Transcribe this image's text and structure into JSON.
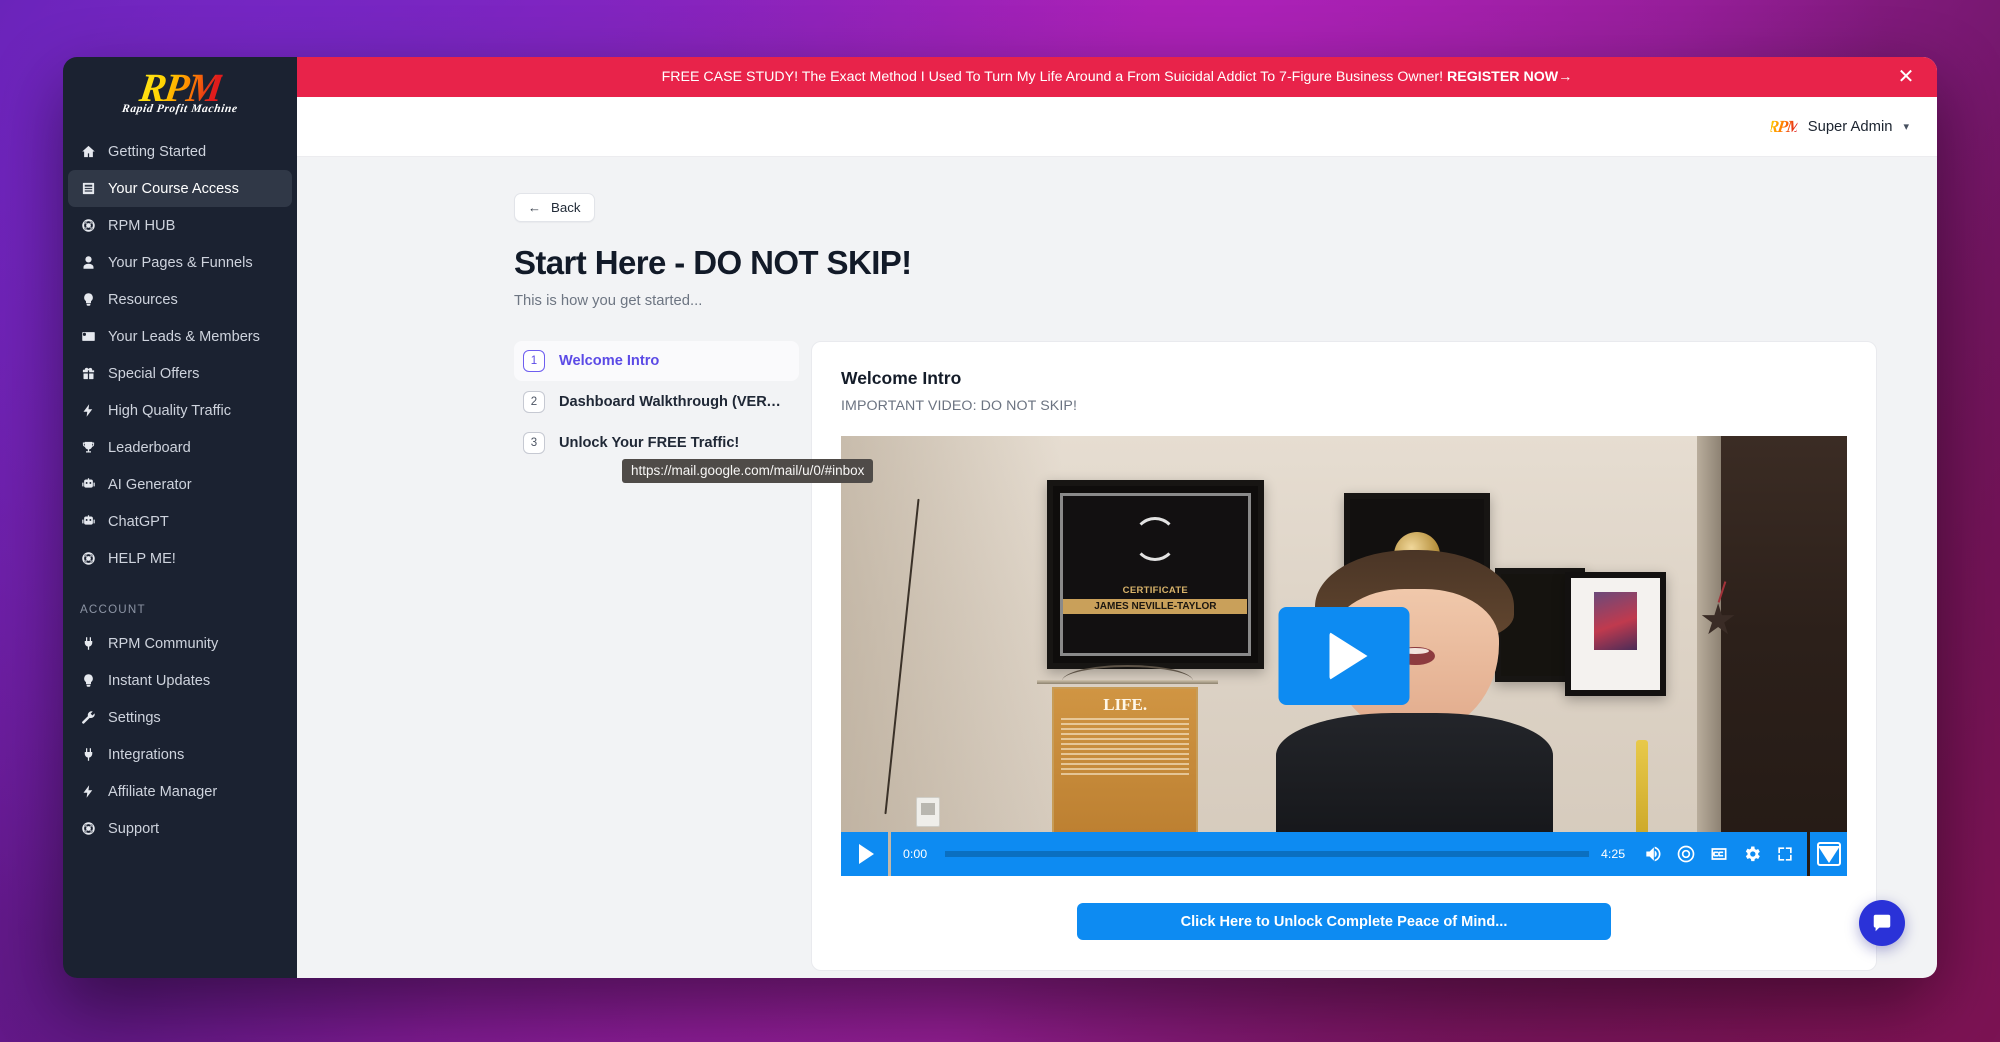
{
  "promo": {
    "text_before": "FREE CASE STUDY! The Exact Method I Used To Turn My Life Around a From Suicidal Addict To 7-Figure Business Owner! ",
    "cta": "REGISTER NOW→",
    "close_icon": "close-icon"
  },
  "brand": {
    "logo_main": "RPM",
    "logo_tagline": "Rapid Profit Machine"
  },
  "topbar": {
    "user_name": "Super Admin",
    "caret": "⌄"
  },
  "sidebar": {
    "items": [
      {
        "label": "Getting Started",
        "icon": "home-icon",
        "active": false
      },
      {
        "label": "Your Course Access",
        "icon": "book-icon",
        "active": true
      },
      {
        "label": "RPM HUB",
        "icon": "lifebuoy-icon",
        "active": false
      },
      {
        "label": "Your Pages & Funnels",
        "icon": "user-icon",
        "active": false
      },
      {
        "label": "Resources",
        "icon": "lightbulb-icon",
        "active": false
      },
      {
        "label": "Your Leads & Members",
        "icon": "contact-card-icon",
        "active": false
      },
      {
        "label": "Special Offers",
        "icon": "gift-icon",
        "active": false
      },
      {
        "label": "High Quality Traffic",
        "icon": "bolt-icon",
        "active": false
      },
      {
        "label": "Leaderboard",
        "icon": "trophy-icon",
        "active": false
      },
      {
        "label": "AI Generator",
        "icon": "robot-icon",
        "active": false
      },
      {
        "label": "ChatGPT",
        "icon": "robot-icon",
        "active": false
      },
      {
        "label": "HELP ME!",
        "icon": "lifebuoy-icon",
        "active": false
      }
    ],
    "account_label": "ACCOUNT",
    "account_items": [
      {
        "label": "RPM Community",
        "icon": "plug-icon"
      },
      {
        "label": "Instant Updates",
        "icon": "lightbulb-icon"
      },
      {
        "label": "Settings",
        "icon": "wrench-icon"
      },
      {
        "label": "Integrations",
        "icon": "plug-icon"
      },
      {
        "label": "Affiliate Manager",
        "icon": "bolt-icon"
      },
      {
        "label": "Support",
        "icon": "lifebuoy-icon"
      }
    ]
  },
  "page": {
    "back_label": "Back",
    "back_arrow": "←",
    "title": "Start Here - DO NOT SKIP!",
    "subtitle": "This is how you get started..."
  },
  "status_tooltip": "https://mail.google.com/mail/u/0/#inbox",
  "lessons": [
    {
      "num": "1",
      "title": "Welcome Intro",
      "active": true
    },
    {
      "num": "2",
      "title": "Dashboard Walkthrough (VERY HEL...",
      "active": false
    },
    {
      "num": "3",
      "title": "Unlock Your FREE Traffic!",
      "active": false
    }
  ],
  "video": {
    "title": "Welcome Intro",
    "subtitle": "IMPORTANT VIDEO: DO NOT SKIP!",
    "current_time": "0:00",
    "duration": "4:25",
    "play_icon": "play-icon",
    "controls": [
      "play-icon",
      "volume-icon",
      "speed-icon",
      "captions-icon",
      "settings-icon",
      "fullscreen-icon",
      "vidalytics-logo-icon"
    ],
    "cert_text": "CERTIFICATE",
    "cert_name": "JAMES NEVILLE-TAYLOR",
    "poster_word": "LIFE."
  },
  "cta": {
    "label": "Click Here to Unlock Complete Peace of Mind..."
  },
  "chat": {
    "icon": "chat-bubble-icon"
  },
  "colors": {
    "promo_red": "#e8234a",
    "sidebar_bg": "#1b2231",
    "accent_blue": "#0d8bf2",
    "lesson_active": "#5b4ae6",
    "chat_blue": "#2a32d8"
  }
}
